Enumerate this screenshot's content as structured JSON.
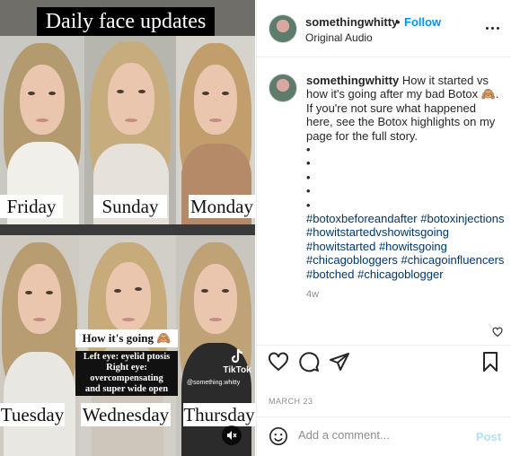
{
  "media": {
    "title": "Daily face updates",
    "days_top": [
      "Friday",
      "Sunday",
      "Monday"
    ],
    "days_bottom": [
      "Tuesday",
      "Wednesday",
      "Thursday"
    ],
    "overlay_heading": "How it's going 🙈",
    "overlay_lines": [
      "Left eye: eyelid ptosis",
      "Right eye:",
      "overcompensating",
      "and super wide open"
    ],
    "tiktok_label": "TikTok",
    "tiktok_handle": "@something.whitty"
  },
  "header": {
    "username": "somethingwhitty",
    "separator": "•",
    "follow_label": "Follow",
    "audio": "Original Audio"
  },
  "caption": {
    "username": "somethingwhitty",
    "text": "How it started vs how it's going after my bad Botox 🙈. If you're not sure what happened here, see the Botox highlights on my page for the full story.",
    "bullets": [
      "•",
      "•",
      "•",
      "•",
      "•"
    ],
    "hashtags": [
      "#botoxbeforeandafter",
      "#botoxinjections",
      "#howitstartedvshowitsgoing",
      "#howitstarted",
      "#howitsgoing",
      "#chicagobloggers",
      "#chicagoinfluencers",
      "#botched",
      "#chicagoblogger"
    ],
    "time_ago": "4w"
  },
  "date": "MARCH 23",
  "comment": {
    "placeholder": "Add a comment...",
    "post_label": "Post"
  },
  "colors": {
    "follow_blue": "#0095f6",
    "hashtag_blue": "#00376b",
    "post_disabled": "#b2dffc"
  }
}
